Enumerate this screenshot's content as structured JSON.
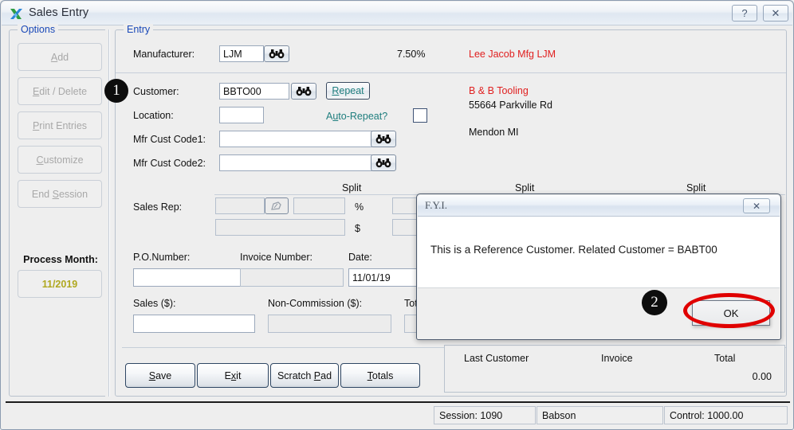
{
  "window": {
    "title": "Sales Entry",
    "app_icon": "x-logo-icon",
    "help_button": "?",
    "close_button": "✕"
  },
  "options_panel": {
    "legend": "Options",
    "buttons": [
      {
        "label": "Add",
        "accel": "A",
        "enabled": false
      },
      {
        "label": "Edit / Delete",
        "accel": "E",
        "enabled": false
      },
      {
        "label": "Print Entries",
        "accel": "P",
        "enabled": false
      },
      {
        "label": "Customize",
        "accel": "C",
        "enabled": false
      },
      {
        "label": "End Session",
        "accel": "S",
        "enabled": false
      }
    ],
    "process_month_label": "Process Month:",
    "process_month_value": "11/2019",
    "process_month_color": "#b0a820"
  },
  "entry_panel": {
    "legend": "Entry",
    "manufacturer": {
      "label": "Manufacturer:",
      "value": "LJM",
      "lookup_icon": "binoculars-icon",
      "rate": "7.50%",
      "name": "Lee Jacob Mfg  LJM"
    },
    "customer": {
      "label": "Customer:",
      "value": "BBTO00",
      "lookup_icon": "binoculars-icon",
      "repeat_label": "Repeat",
      "repeat_accel": "R",
      "name": "B & B Tooling",
      "address": "55664 Parkville Rd",
      "city_state": "Mendon MI"
    },
    "location": {
      "label": "Location:",
      "value": ""
    },
    "auto_repeat": {
      "label": "Auto-Repeat?",
      "accel": "u",
      "checked": false
    },
    "mfr_cust_code1": {
      "label": "Mfr Cust Code1:",
      "value": ""
    },
    "mfr_cust_code2": {
      "label": "Mfr Cust Code2:",
      "value": ""
    },
    "split_label": "Split",
    "sales_rep": {
      "label": "Sales Rep:",
      "rep1": "",
      "rep2": "",
      "rep3": "",
      "split_pct": "",
      "split_pct2": "",
      "split_pct3": "",
      "split_amt": "",
      "split_amt2": "",
      "split_amt3": "",
      "pct_symbol": "%",
      "dollar_symbol": "$",
      "edit_icon": "pencil-icon"
    },
    "po_number": {
      "label": "P.O.Number:",
      "value": ""
    },
    "invoice_number": {
      "label": "Invoice Number:",
      "value": ""
    },
    "date": {
      "label": "Date:",
      "value": "11/01/19"
    },
    "sales": {
      "label": "Sales ($):",
      "value": ""
    },
    "non_commission": {
      "label": "Non-Commission ($):",
      "value": ""
    },
    "total": {
      "label": "Total",
      "value": ""
    },
    "buttons": [
      {
        "label": "Save",
        "accel": "S"
      },
      {
        "label": "Exit",
        "accel": "x"
      },
      {
        "label": "Scratch Pad",
        "accel": "P"
      },
      {
        "label": "Totals",
        "accel": "T"
      }
    ]
  },
  "last_customer_panel": {
    "col_customer": "Last Customer",
    "col_invoice": "Invoice",
    "col_total": "Total",
    "total_value": "0.00"
  },
  "statusbar": {
    "session": "Session: 1090",
    "user": "Babson",
    "control": "Control:   1000.00"
  },
  "dialog": {
    "title": "F.Y.I.",
    "close_icon": "close-icon",
    "message": "This is a Reference Customer. Related Customer = BABT00",
    "ok_label": "OK"
  },
  "annotations": {
    "badge1": "1",
    "badge2": "2",
    "highlight_color": "#e00000"
  }
}
